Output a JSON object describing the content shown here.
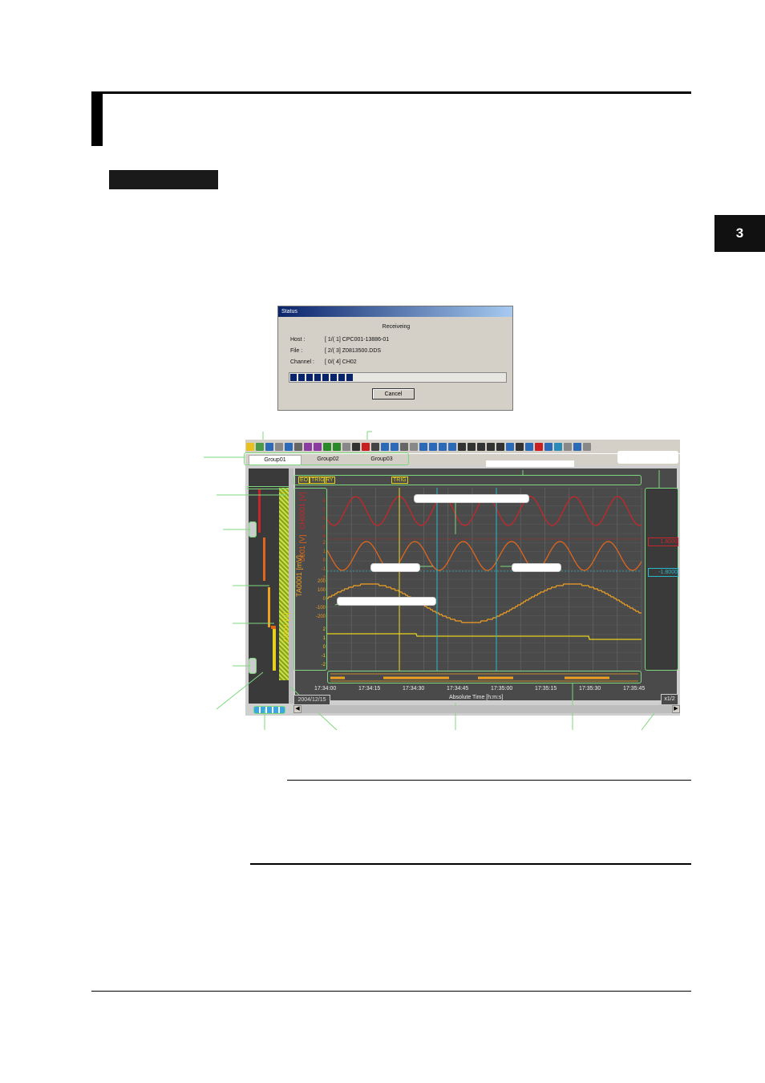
{
  "page": {
    "chapter_tab": "3"
  },
  "status_dialog": {
    "title": "Status",
    "state": "Receiveing",
    "host_label": "Host :",
    "host_value": "[ 1/( 1] CPC001-13886-01",
    "file_label": "File :",
    "file_value": "[ 2/( 3] Z0813500.DDS",
    "channel_label": "Channel :",
    "channel_value": "[ 0/( 4] CH02",
    "progress": 0.3,
    "cancel_label": "Cancel"
  },
  "app": {
    "tabs": [
      "Group01",
      "Group02",
      "Group03"
    ],
    "event_marks": [
      "EO",
      "TRIG",
      "RY",
      "TRIG"
    ],
    "channels": [
      "CH01 [V]",
      "TA0001 [mV]",
      "0001 [V]",
      "CH0001 [V]"
    ],
    "y_ticks_top": [
      "4",
      "2",
      "0",
      "-2",
      "-4"
    ],
    "y_ticks_mid": [
      "2",
      "1",
      "0",
      "-1",
      "-2"
    ],
    "y_ticks_low": [
      "200",
      "100",
      "0",
      "-100",
      "-200"
    ],
    "y_ticks_bot": [
      "2",
      "1",
      "0",
      "-1",
      "-2"
    ],
    "right_values": [
      "1.8000",
      "-1.8000"
    ],
    "date": "2004/12/15",
    "x_ticks": [
      "17:34:00",
      "17:34:15",
      "17:34:30",
      "17:34:45",
      "17:35:00",
      "17:35:15",
      "17:35:30",
      "17:35:45"
    ],
    "x_axis_label": "Absolute Time [h:m:s]",
    "zoom": "x1/2",
    "colors": {
      "plot_bg": "#4a4a4a",
      "trace_red": "#c8262a",
      "trace_orange": "#e0661c",
      "trace_amber": "#f0a020",
      "trace_yellow": "#e6d21e",
      "cursor_cyan": "#2ab8c8",
      "callout_green": "#7dd87d"
    }
  }
}
